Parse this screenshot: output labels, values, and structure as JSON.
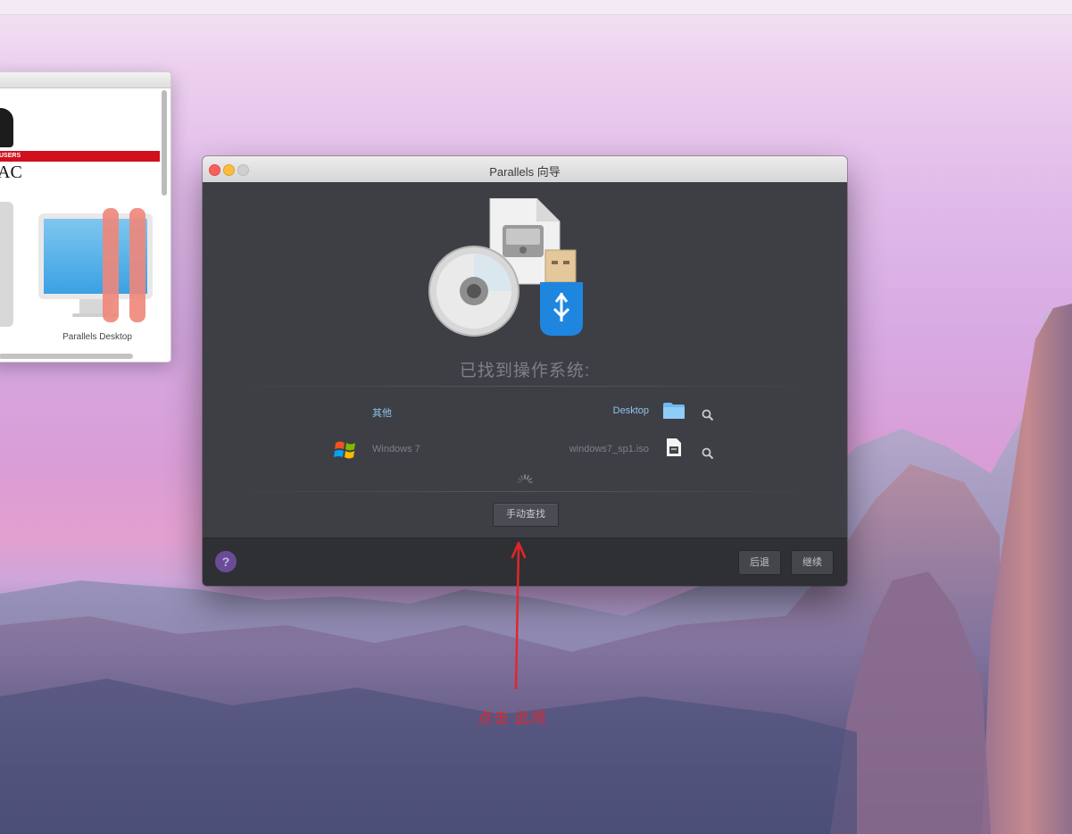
{
  "window": {
    "title": "Parallels 向导"
  },
  "background_window": {
    "banner_text": "USERS",
    "big_text": "AC",
    "caption": "Parallels Desktop"
  },
  "wizard": {
    "heading": "已找到操作系统:",
    "rows": [
      {
        "name": "其他",
        "location": "Desktop",
        "icon": "folder-icon"
      },
      {
        "name": "Windows 7",
        "location": "windows7_sp1.iso",
        "icon": "iso-file-icon"
      }
    ],
    "manual_button": "手动查找"
  },
  "footer": {
    "help_label": "?",
    "back_button": "后退",
    "continue_button": "继续"
  },
  "annotation": {
    "text": "点击 此项",
    "color": "#e3262b"
  },
  "colors": {
    "accent_link": "#8fc3ec",
    "help_purple": "#6a4c96",
    "window_dark": "#3d3f45"
  }
}
